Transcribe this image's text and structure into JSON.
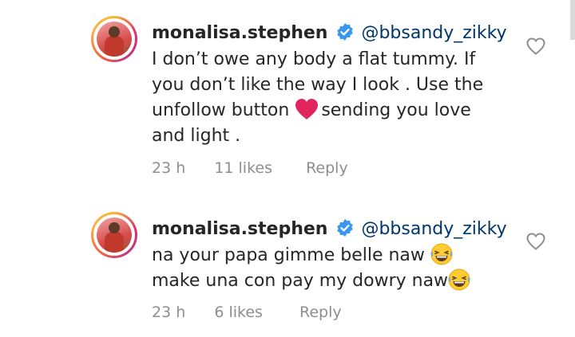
{
  "comments": [
    {
      "username": "monalisa.stephen",
      "mention": "@bbsandy_zikky",
      "lines": [
        "I don’t owe any body a flat tummy. If",
        "you don’t like the way I look . Use the",
        "unfollow button",
        "sending you love",
        "and light ."
      ],
      "time": "23 h",
      "likes": "11 likes",
      "reply": "Reply"
    },
    {
      "username": "monalisa.stephen",
      "mention": "@bbsandy_zikky",
      "lines": [
        "na your papa gimme belle naw",
        "make una con pay my dowry naw"
      ],
      "time": "23 h",
      "likes": "6 likes",
      "reply": "Reply"
    }
  ],
  "colors": {
    "text": "#262626",
    "mention": "#00376b",
    "meta": "#8e8e8e",
    "verified": "#3897f0",
    "heart_emoji": "#e0245e"
  },
  "icons": [
    "verified-badge-icon",
    "heart-outline-icon",
    "red-heart-emoji",
    "laughing-emoji"
  ]
}
